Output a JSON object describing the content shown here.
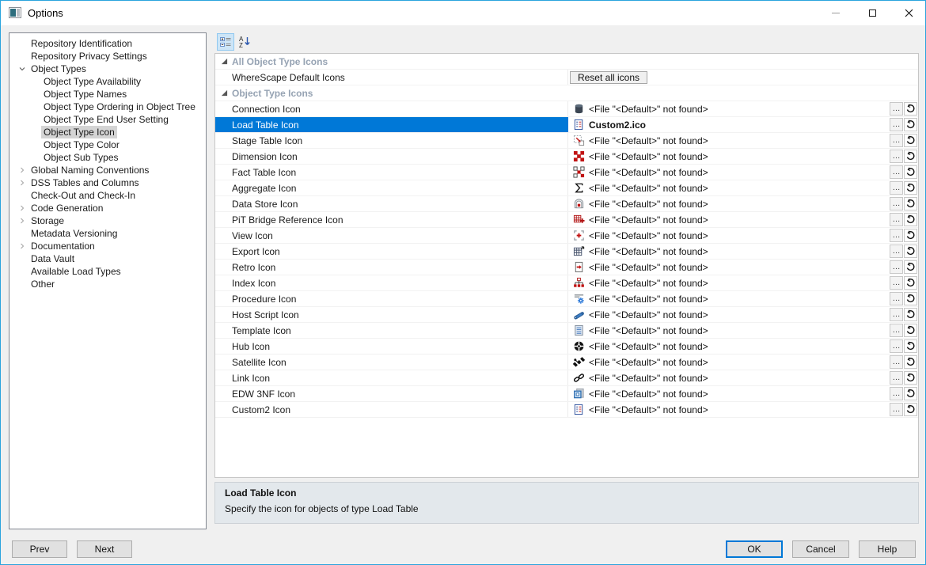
{
  "window": {
    "title": "Options",
    "controls": {
      "minimize": "minimize",
      "maximize": "maximize",
      "close": "close"
    }
  },
  "sidebar": {
    "items": [
      {
        "label": "Repository Identification",
        "level": 0,
        "expander": "none",
        "selected": false
      },
      {
        "label": "Repository Privacy Settings",
        "level": 0,
        "expander": "none",
        "selected": false
      },
      {
        "label": "Object Types",
        "level": 0,
        "expander": "expanded",
        "selected": false
      },
      {
        "label": "Object Type Availability",
        "level": 1,
        "expander": "none",
        "selected": false
      },
      {
        "label": "Object Type Names",
        "level": 1,
        "expander": "none",
        "selected": false
      },
      {
        "label": "Object Type Ordering in Object Tree",
        "level": 1,
        "expander": "none",
        "selected": false
      },
      {
        "label": "Object Type End User Setting",
        "level": 1,
        "expander": "none",
        "selected": false
      },
      {
        "label": "Object Type Icon",
        "level": 1,
        "expander": "none",
        "selected": true
      },
      {
        "label": "Object Type Color",
        "level": 1,
        "expander": "none",
        "selected": false
      },
      {
        "label": "Object Sub Types",
        "level": 1,
        "expander": "none",
        "selected": false
      },
      {
        "label": "Global Naming Conventions",
        "level": 0,
        "expander": "collapsed",
        "selected": false
      },
      {
        "label": "DSS Tables and Columns",
        "level": 0,
        "expander": "collapsed",
        "selected": false
      },
      {
        "label": "Check-Out and Check-In",
        "level": 0,
        "expander": "none",
        "selected": false
      },
      {
        "label": "Code Generation",
        "level": 0,
        "expander": "collapsed",
        "selected": false
      },
      {
        "label": "Storage",
        "level": 0,
        "expander": "collapsed",
        "selected": false
      },
      {
        "label": "Metadata Versioning",
        "level": 0,
        "expander": "none",
        "selected": false
      },
      {
        "label": "Documentation",
        "level": 0,
        "expander": "collapsed",
        "selected": false
      },
      {
        "label": "Data Vault",
        "level": 0,
        "expander": "none",
        "selected": false
      },
      {
        "label": "Available Load Types",
        "level": 0,
        "expander": "none",
        "selected": false
      },
      {
        "label": "Other",
        "level": 0,
        "expander": "none",
        "selected": false
      }
    ]
  },
  "grid": {
    "row_actions": {
      "browse": "…"
    },
    "categories": [
      {
        "label": "All Object Type Icons",
        "rows": [
          {
            "label": "WhereScape Default Icons",
            "type": "button",
            "button_label": "Reset all icons"
          }
        ]
      },
      {
        "label": "Object Type Icons",
        "rows": [
          {
            "label": "Connection Icon",
            "icon": "connection",
            "value": "<File \"<Default>\" not found>",
            "selected": false,
            "bold": false
          },
          {
            "label": "Load Table Icon",
            "icon": "load-table",
            "value": "Custom2.ico",
            "selected": true,
            "bold": true
          },
          {
            "label": "Stage Table Icon",
            "icon": "stage-table",
            "value": "<File \"<Default>\" not found>",
            "selected": false,
            "bold": false
          },
          {
            "label": "Dimension Icon",
            "icon": "dimension",
            "value": "<File \"<Default>\" not found>",
            "selected": false,
            "bold": false
          },
          {
            "label": "Fact Table Icon",
            "icon": "fact-table",
            "value": "<File \"<Default>\" not found>",
            "selected": false,
            "bold": false
          },
          {
            "label": "Aggregate Icon",
            "icon": "aggregate",
            "value": "<File \"<Default>\" not found>",
            "selected": false,
            "bold": false
          },
          {
            "label": "Data Store Icon",
            "icon": "data-store",
            "value": "<File \"<Default>\" not found>",
            "selected": false,
            "bold": false
          },
          {
            "label": "PiT Bridge Reference Icon",
            "icon": "pit-bridge-reference",
            "value": "<File \"<Default>\" not found>",
            "selected": false,
            "bold": false
          },
          {
            "label": "View Icon",
            "icon": "view",
            "value": "<File \"<Default>\" not found>",
            "selected": false,
            "bold": false
          },
          {
            "label": "Export Icon",
            "icon": "export",
            "value": "<File \"<Default>\" not found>",
            "selected": false,
            "bold": false
          },
          {
            "label": "Retro Icon",
            "icon": "retro",
            "value": "<File \"<Default>\" not found>",
            "selected": false,
            "bold": false
          },
          {
            "label": "Index Icon",
            "icon": "index",
            "value": "<File \"<Default>\" not found>",
            "selected": false,
            "bold": false
          },
          {
            "label": "Procedure Icon",
            "icon": "procedure",
            "value": "<File \"<Default>\" not found>",
            "selected": false,
            "bold": false
          },
          {
            "label": "Host Script Icon",
            "icon": "host-script",
            "value": "<File \"<Default>\" not found>",
            "selected": false,
            "bold": false
          },
          {
            "label": "Template Icon",
            "icon": "template",
            "value": "<File \"<Default>\" not found>",
            "selected": false,
            "bold": false
          },
          {
            "label": "Hub Icon",
            "icon": "hub",
            "value": "<File \"<Default>\" not found>",
            "selected": false,
            "bold": false
          },
          {
            "label": "Satellite Icon",
            "icon": "satellite",
            "value": "<File \"<Default>\" not found>",
            "selected": false,
            "bold": false
          },
          {
            "label": "Link Icon",
            "icon": "link",
            "value": "<File \"<Default>\" not found>",
            "selected": false,
            "bold": false
          },
          {
            "label": "EDW 3NF Icon",
            "icon": "edw-3nf",
            "value": "<File \"<Default>\" not found>",
            "selected": false,
            "bold": false
          },
          {
            "label": "Custom2 Icon",
            "icon": "custom2",
            "value": "<File \"<Default>\" not found>",
            "selected": false,
            "bold": false
          }
        ]
      }
    ]
  },
  "description": {
    "title": "Load Table Icon",
    "text": "Specify the icon for objects of type Load Table"
  },
  "footer": {
    "prev_label": "Prev",
    "next_label": "Next",
    "ok_label": "OK",
    "cancel_label": "Cancel",
    "help_label": "Help"
  },
  "colors": {
    "window_border": "#2aa4dd",
    "selection_blue": "#0078d7",
    "category_text": "#96a3b3",
    "description_bg": "#e3e8ec",
    "titlebar_bg": "#ffffff",
    "dialog_bg": "#f0f0f0"
  }
}
